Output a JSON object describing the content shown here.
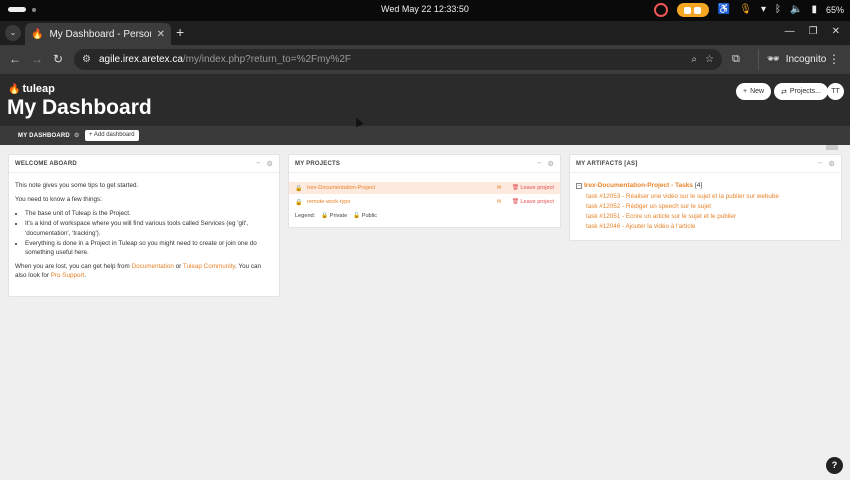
{
  "os": {
    "clock": "Wed May 22  12:33:50",
    "battery": "65%"
  },
  "browser": {
    "tab_title": "My Dashboard - Personal",
    "url_host": "agile.irex.aretex.ca",
    "url_path": "/my/index.php?return_to=%2Fmy%2F",
    "incognito_label": "Incognito"
  },
  "header": {
    "logo_text": "tuleap",
    "page_title": "My Dashboard",
    "new_button": "New",
    "projects_button": "Projects...",
    "avatar_initials": "TT"
  },
  "subnav": {
    "tab_label": "MY DASHBOARD",
    "add_dashboard": "Add dashboard"
  },
  "welcome": {
    "title": "WELCOME ABOARD",
    "intro": "This note gives you some tips to get started.",
    "need_to_know": "You need to know a few things:",
    "bullets": [
      "The base unit of Tuleap is the Project.",
      "It's a kind of workspace where you will find various tools called Services (eg 'git', 'documentation', 'tracking').",
      "Everything is done in a Project in Tuleap so you might need to create or join one do something useful here."
    ],
    "help_prefix": "When you are lost, you can get help from ",
    "documentation_link": "Documentation",
    "or": " or ",
    "community_link": "Tuleap Community",
    "help_suffix": ". You can also look for ",
    "pro_support_link": "Pro Support",
    "end": "."
  },
  "projects": {
    "title": "MY PROJECTS",
    "rows": [
      {
        "name": "Irex-Documentation-Project",
        "leave": "Leave project"
      },
      {
        "name": "remote-work-typo",
        "leave": "Leave project"
      }
    ],
    "legend_label": "Legend:",
    "legend_private": "Private",
    "legend_public": "Public"
  },
  "artifacts": {
    "title": "MY ARTIFACTS [AS]",
    "group_name": "Irex-Documentation-Project - Tasks",
    "group_count": "[4]",
    "items": [
      "task #12053 - Réaliser une vidéo sur le sujet et la publier sur webube",
      "task #12052 - Rédiger un speech sur le sujet",
      "task #12051 - Ecrire un article sur le sujet et le publier",
      "task #12046 - Ajouter la vidéo à l'article"
    ]
  },
  "colors": {
    "accent": "#e8832a",
    "header_bg": "#2b2b2b",
    "leave": "#e05050"
  }
}
